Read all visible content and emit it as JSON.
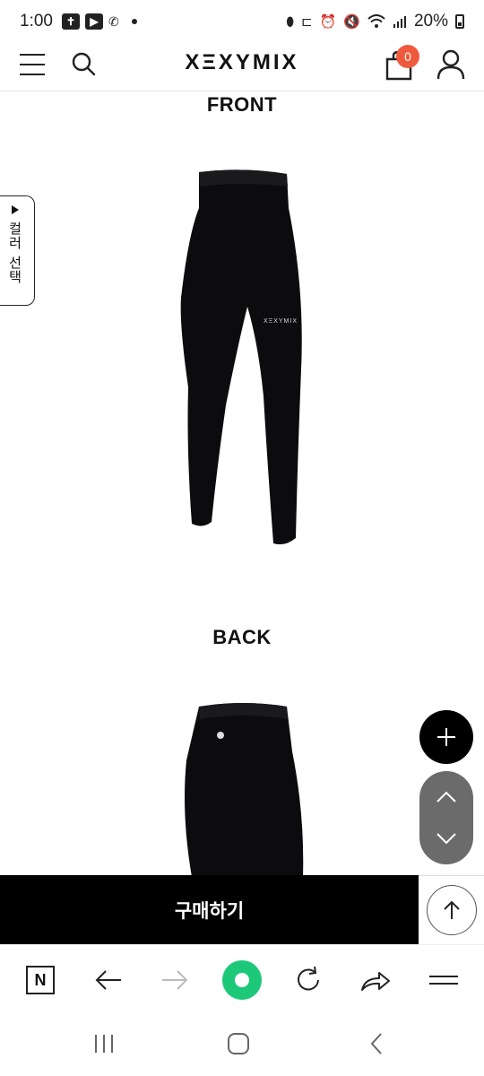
{
  "status_bar": {
    "time": "1:00",
    "battery": "20%"
  },
  "header": {
    "logo": "XΞXYMIX",
    "cart_count": "0"
  },
  "product_images": {
    "front_label": "FRONT",
    "back_label": "BACK"
  },
  "side_tab": {
    "label": "컬러 선택"
  },
  "buy_bar": {
    "buy_label": "구매하기"
  },
  "browser_toolbar": {
    "n_label": "N"
  },
  "colors": {
    "accent": "#f05a3c",
    "browser_green": "#1dc978",
    "fab_gray": "#6b6b6b"
  }
}
